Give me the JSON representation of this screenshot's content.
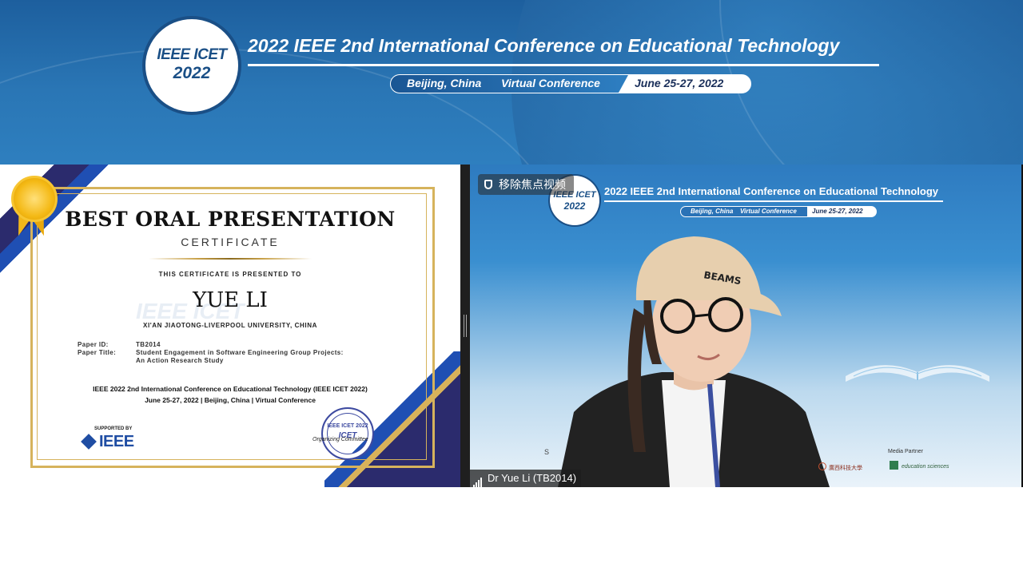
{
  "banner": {
    "logo_line1": "IEEE ICET",
    "logo_line2": "2022",
    "title": "2022 IEEE 2nd International Conference on Educational Technology",
    "location": "Beijing, China",
    "mode": "Virtual Conference",
    "dates": "June 25-27, 2022",
    "colors": {
      "primary": "#1d5f9e",
      "accent": "#2d7dc0"
    }
  },
  "certificate": {
    "heading": "BEST ORAL PRESENTATION",
    "subheading": "CERTIFICATE",
    "presented_to": "THIS CERTIFICATE IS PRESENTED TO",
    "recipient": "YUE LI",
    "university": "XI'AN JIAOTONG-LIVERPOOL UNIVERSITY, CHINA",
    "watermark": "IEEE ICET",
    "paper_id_label": "Paper ID:",
    "paper_id": "TB2014",
    "paper_title_label": "Paper Title:",
    "paper_title_line1": "Student Engagement in Software Engineering Group Projects:",
    "paper_title_line2": "An Action Research Study",
    "event_line1": "IEEE 2022 2nd International Conference on Educational Technology (IEEE ICET 2022)",
    "event_line2": "June 25-27, 2022 | Beijing, China | Virtual Conference",
    "supported_by": "SUPPORTED BY",
    "ieee": "IEEE",
    "seal_line1": "IEEE ICET 2022",
    "seal_line2": "ICET",
    "organizing": "Organizing Committee",
    "icons": [
      "award-medal-icon",
      "ieee-logo-icon",
      "seal-stamp-icon"
    ]
  },
  "video": {
    "unpin_label": "移除焦点视频",
    "logo_line1": "IEEE ICET",
    "logo_line2": "2022",
    "title": "2022 IEEE 2nd International Conference on Educational Technology",
    "location": "Beijing, China",
    "mode": "Virtual Conference",
    "dates": "June 25-27, 2022",
    "media_partner": "Media Partner",
    "media_partner_name": "education sciences",
    "sponsor_initial": "S",
    "cn_partner": "廣西科技大學",
    "participant_name": "Dr Yue Li (TB2014)",
    "icons": [
      "pin-icon",
      "signal-bars-icon"
    ]
  }
}
